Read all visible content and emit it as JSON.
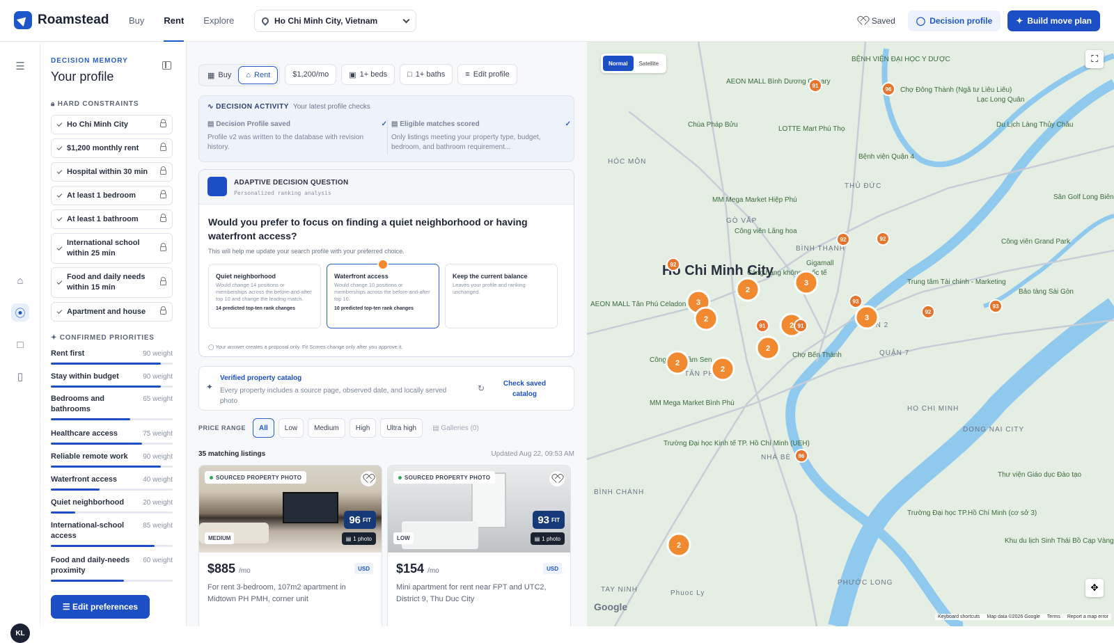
{
  "brand": {
    "name": "Roamstead"
  },
  "nav": [
    {
      "label": "Buy"
    },
    {
      "label": "Rent"
    },
    {
      "label": "Explore"
    }
  ],
  "location": {
    "value": "Ho Chi Minh City, Vietnam",
    "icon": "pin-icon"
  },
  "topbar": {
    "saved_label": "Saved",
    "decision_profile_label": "Decision profile",
    "build_plan_label": "Build move plan",
    "accent": "#1d4fc4"
  },
  "user": {
    "initials": "KL"
  },
  "sidebar": {
    "eyebrow": "DECISION MEMORY",
    "title": "Your profile",
    "hard_constraints_heading": "HARD CONSTRAINTS",
    "constraints": [
      {
        "label": "Ho Chi Minh City"
      },
      {
        "label": "$1,200 monthly rent"
      },
      {
        "label": "Hospital within 30 min"
      },
      {
        "label": "At least 1 bedroom"
      },
      {
        "label": "At least 1 bathroom"
      },
      {
        "label": "International school within 25 min"
      },
      {
        "label": "Food and daily needs within 15 min"
      },
      {
        "label": "Apartment and house"
      }
    ],
    "priorities_heading": "CONFIRMED PRIORITIES",
    "priorities": [
      {
        "label": "Rent first",
        "weight": "90 weight",
        "value": 90
      },
      {
        "label": "Stay within budget",
        "weight": "90 weight",
        "value": 90
      },
      {
        "label": "Bedrooms and bathrooms",
        "weight": "65 weight",
        "value": 65
      },
      {
        "label": "Healthcare access",
        "weight": "75 weight",
        "value": 75
      },
      {
        "label": "Reliable remote work",
        "weight": "90 weight",
        "value": 90
      },
      {
        "label": "Waterfront access",
        "weight": "40 weight",
        "value": 40
      },
      {
        "label": "Quiet neighborhood",
        "weight": "20 weight",
        "value": 20
      },
      {
        "label": "International-school access",
        "weight": "85 weight",
        "value": 85
      },
      {
        "label": "Food and daily-needs proximity",
        "weight": "60 weight",
        "value": 60
      }
    ],
    "edit_label": "Edit preferences"
  },
  "filters": {
    "buy_label": "Buy",
    "rent_label": "Rent",
    "budget_label": "$1,200/mo",
    "beds_label": "1+ beds",
    "baths_label": "1+ baths",
    "edit_label": "Edit profile"
  },
  "activity": {
    "heading": "DECISION ACTIVITY",
    "subheading": "Your latest profile checks",
    "items": [
      {
        "title": "Decision Profile saved",
        "text": "Profile v2 was written to the database with revision history."
      },
      {
        "title": "Eligible matches scored",
        "text": "Only listings meeting your property type, budget, bedroom, and bathroom requirement..."
      }
    ]
  },
  "question": {
    "heading": "ADAPTIVE DECISION QUESTION",
    "subheading": "Personalized ranking analysis",
    "text": "Would you prefer to focus on finding a quiet neighborhood or having waterfront access?",
    "hint": "This will help me update your search profile with your preferred choice.",
    "options": [
      {
        "title": "Quiet neighborhood",
        "desc": "Would change 14 positions or memberships across the before-and-after top 10 and change the leading match.",
        "impact": "14 predicted top-ten rank changes"
      },
      {
        "title": "Waterfront access",
        "desc": "Would change 10 positions or memberships across the before-and-after top 10.",
        "impact": "10 predicted top-ten rank changes"
      },
      {
        "title": "Keep the current balance",
        "desc": "Leaves your profile and ranking unchanged.",
        "impact": ""
      }
    ],
    "footnote": "Your answer creates a proposal only. Fit Scores change only after you approve it."
  },
  "catalog": {
    "title": "Verified property catalog",
    "text": "Every property includes a source page, observed date, and locally served photo",
    "action": "Check saved catalog"
  },
  "price_range": {
    "label": "PRICE RANGE",
    "options": [
      "All",
      "Low",
      "Medium",
      "High",
      "Ultra high"
    ],
    "selected": "All",
    "galleries": "Galleries (0)"
  },
  "results": {
    "count": "35 matching listings",
    "updated": "Updated Aug 22, 09:53 AM"
  },
  "listings": [
    {
      "badge": "SOURCED PROPERTY PHOTO",
      "fit": "96",
      "fit_suffix": "FIT",
      "tier": "MEDIUM",
      "photos": "1 photo",
      "price": "$885",
      "period": "/mo",
      "currency": "USD",
      "title": "For rent 3-bedroom, 107m2 apartment in Midtown PH PMH, corner unit"
    },
    {
      "badge": "SOURCED PROPERTY PHOTO",
      "fit": "93",
      "fit_suffix": "FIT",
      "tier": "LOW",
      "photos": "1 photo",
      "price": "$154",
      "period": "/mo",
      "currency": "USD",
      "title": "Mini apartment for rent near FPT and UTC2, District 9, Thu Duc City"
    }
  ],
  "map": {
    "toggle": [
      "Normal",
      "Satellite"
    ],
    "selected": "Normal",
    "city_label": "Ho Chi Minh City",
    "clusters": [
      "3",
      "2",
      "2",
      "2",
      "3",
      "3",
      "2",
      "2",
      "2",
      "2"
    ],
    "prices": [
      "91",
      "96",
      "92",
      "93",
      "92",
      "91",
      "91",
      "92",
      "86",
      "93",
      "92"
    ],
    "places": [
      "BỆNH VIỆN ĐẠI HỌC Y DƯỢC",
      "Chùa Pháp Bửu",
      "LOTTE Mart Phú Thọ",
      "AEON MALL Bình Dương Canary",
      "Chợ Đông Thành (Ngã tư Liêu Liêu)",
      "Lạc Long Quân",
      "Du Lịch Làng Thủy Châu",
      "Bệnh viện Quận 4",
      "Sân Golf Long Biên",
      "MM Mega Market Hiệp Phú",
      "Công viên Lãng hoa",
      "Gigamall",
      "Công viên Grand Park",
      "Cảng hàng không quốc tế",
      "AEON MALL Tân Phú Celadon",
      "Công viên Đầm Sen",
      "MM Mega Market Bình Phú",
      "Chợ Bến Thành",
      "Trung tâm Tài chính - Marketing",
      "Bảo tàng Sài Gòn",
      "Trường Đại học Kinh tế TP. Hồ Chí Minh (UEH)",
      "Thư viện Giáo dục Đào tạo",
      "Trường Đại học TP.Hồ Chí Minh (cơ sở 3)",
      "Khu du lịch Sinh Thái Bồ Cạp Vàng"
    ],
    "districts": [
      "THỦ ĐỨC",
      "HÓC MÔN",
      "BÌNH THẠNH",
      "QUẬN 2",
      "QUẬN 7",
      "NHÀ BÈ",
      "BÌNH CHÁNH",
      "TÂN PHÚ",
      "GÒ VẤP",
      "PHƯỚC LONG",
      "DONG NAI CITY",
      "HO CHI MINH",
      "TAY NINH",
      "Phuoc Ly"
    ],
    "attribution": [
      "Keyboard shortcuts",
      "Map data ©2026 Google",
      "Terms",
      "Report a map error"
    ],
    "google": "Google",
    "water": "#8fc9ee",
    "land": "#e5eee3",
    "cluster_color": "#f0892f",
    "price_color": "#e8732a"
  }
}
